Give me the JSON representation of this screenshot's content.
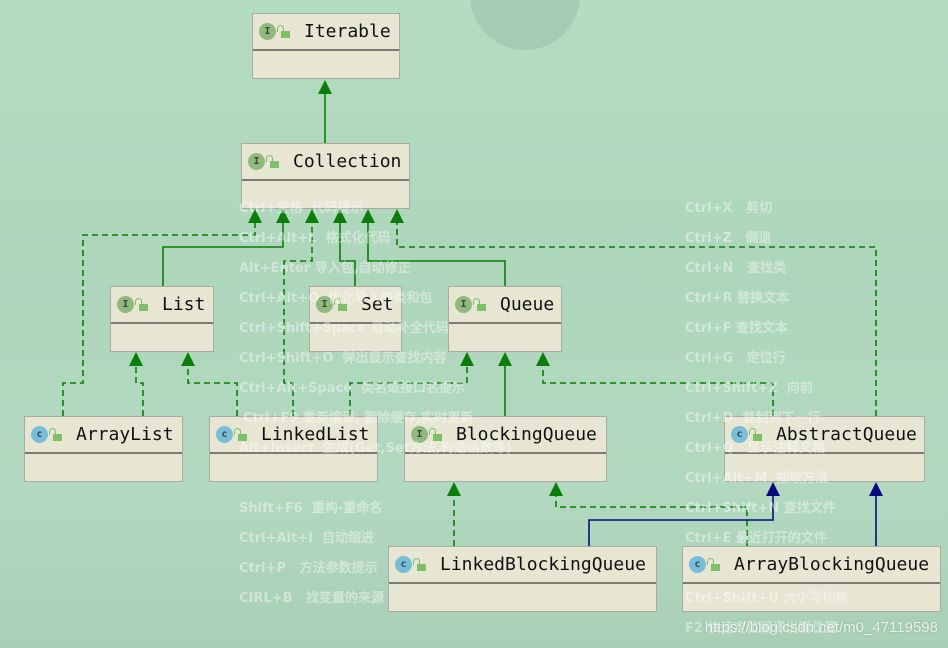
{
  "colors": {
    "background": "#b0d8bd",
    "box": "#e6e6d3",
    "implements": "#0a7d0a",
    "extends_interface": "#0a7d0a",
    "extends_class": "#0a0a80",
    "interface_icon": "#8fb97d",
    "class_icon": "#79bdd6"
  },
  "nodes": [
    {
      "id": "Iterable",
      "kind": "interface",
      "icon": "I"
    },
    {
      "id": "Collection",
      "kind": "interface",
      "icon": "I"
    },
    {
      "id": "List",
      "kind": "interface",
      "icon": "I"
    },
    {
      "id": "Set",
      "kind": "interface",
      "icon": "I"
    },
    {
      "id": "Queue",
      "kind": "interface",
      "icon": "I"
    },
    {
      "id": "ArrayList",
      "kind": "class",
      "icon": "c"
    },
    {
      "id": "LinkedList",
      "kind": "class",
      "icon": "c"
    },
    {
      "id": "BlockingQueue",
      "kind": "interface",
      "icon": "I"
    },
    {
      "id": "AbstractQueue",
      "kind": "class",
      "icon": "c"
    },
    {
      "id": "LinkedBlockingQueue",
      "kind": "class",
      "icon": "c"
    },
    {
      "id": "ArrayBlockingQueue",
      "kind": "class",
      "icon": "c"
    }
  ],
  "edges": [
    {
      "from": "Collection",
      "to": "Iterable",
      "type": "extends"
    },
    {
      "from": "ArrayList",
      "to": "Collection",
      "type": "implements"
    },
    {
      "from": "List",
      "to": "Collection",
      "type": "extends"
    },
    {
      "from": "LinkedList",
      "to": "Collection",
      "type": "implements"
    },
    {
      "from": "Set",
      "to": "Collection",
      "type": "extends"
    },
    {
      "from": "Queue",
      "to": "Collection",
      "type": "extends"
    },
    {
      "from": "AbstractQueue",
      "to": "Collection",
      "type": "implements"
    },
    {
      "from": "ArrayList",
      "to": "List",
      "type": "implements"
    },
    {
      "from": "LinkedList",
      "to": "List",
      "type": "implements"
    },
    {
      "from": "LinkedList",
      "to": "Queue",
      "type": "implements"
    },
    {
      "from": "BlockingQueue",
      "to": "Queue",
      "type": "extends"
    },
    {
      "from": "AbstractQueue",
      "to": "Queue",
      "type": "implements"
    },
    {
      "from": "LinkedBlockingQueue",
      "to": "BlockingQueue",
      "type": "implements"
    },
    {
      "from": "ArrayBlockingQueue",
      "to": "BlockingQueue",
      "type": "implements"
    },
    {
      "from": "LinkedBlockingQueue",
      "to": "AbstractQueue",
      "type": "extends-class"
    },
    {
      "from": "ArrayBlockingQueue",
      "to": "AbstractQueue",
      "type": "extends-class"
    }
  ],
  "shortcuts_left": [
    "Ctrl+空格  代码提示",
    "Ctrl+Alt+L  格式化代码",
    "Alt+Enter 导入包,自动修正",
    "Ctrl+Alt+O  优化导入的类和包",
    "Ctrl+Shift+Space 自动补全代码",
    "Ctrl+Shift+O  弹出显示查找内容",
    "Ctrl+Alt+Space  类名或接口名提示",
    "Ctrl+F9 重新编译, 删除缓存,实时更新",
    "Alt+Insert  生成(Get,Set方法,构造函数等)",
    "Shift+F6  重构-重命名",
    "Ctrl+Alt+I  自动缩进",
    "Ctrl+P   方法参数提示",
    "CIRL+B   找变量的来源"
  ],
  "shortcuts_right": [
    "Ctrl+X   剪切",
    "Ctrl+Z   倒退",
    "Ctrl+N   查找类",
    "Ctrl+R 替换文本",
    "Ctrl+F 查找文本",
    "Ctrl+G   定位行",
    "Ctrl+Shift+Z  向前",
    "Ctrl+D  复制到下一行",
    "Ctrl+Q   显示注释文档",
    "Ctrl+Alt+M  抽取方法",
    "Ctrl+Shift+N 查找文件",
    "Ctrl+E 最近打开的文件",
    "Ctrl+Shift+U 大小写切换",
    "F2 快速定位编译出错位置"
  ],
  "watermark": "https://blog.csdn.net/m0_47119598"
}
